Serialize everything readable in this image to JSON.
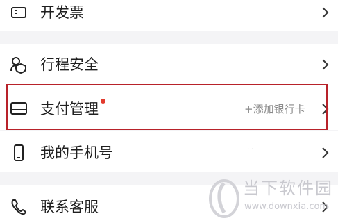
{
  "menu": {
    "invoice": {
      "label": "开发票",
      "icon": "invoice-icon"
    },
    "trip_safety": {
      "label": "行程安全",
      "icon": "users-shield-icon"
    },
    "payment": {
      "label": "支付管理",
      "icon": "card-icon",
      "hint": "+添加银行卡",
      "badge_color": "#e23b2e"
    },
    "phone": {
      "label": "我的手机号",
      "icon": "phone-icon",
      "value_dots": "·   ·"
    },
    "support": {
      "label": "联系客服",
      "icon": "headset-phone-icon"
    }
  },
  "highlight_color": "#b8222a",
  "watermark": {
    "title": "当下软件园",
    "url": "www.downxia.com"
  }
}
